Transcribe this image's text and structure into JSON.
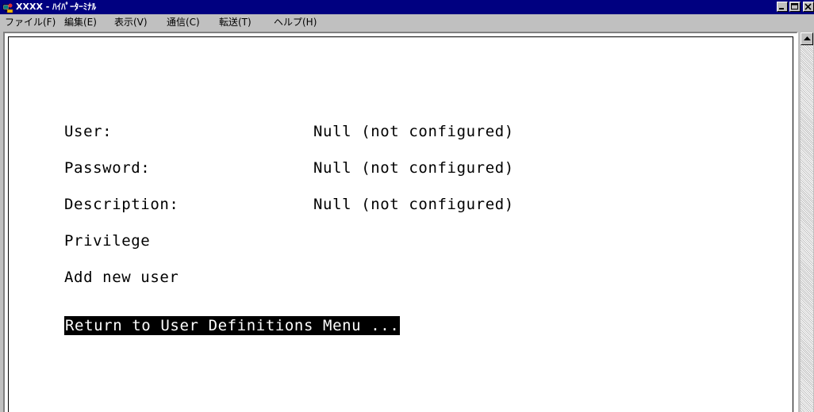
{
  "window": {
    "title": "XXXX - ﾊｲﾊﾟｰﾀｰﾐﾅﾙ"
  },
  "menu": [
    {
      "label": "ファイル(F)"
    },
    {
      "label": "編集(E)"
    },
    {
      "label": "表示(V)"
    },
    {
      "label": "通信(C)"
    },
    {
      "label": "転送(T)"
    },
    {
      "label": "ヘルプ(H)"
    }
  ],
  "terminal": {
    "fields": [
      {
        "label": "User:",
        "value": "Null (not configured)"
      },
      {
        "label": "Password:",
        "value": "Null (not configured)"
      },
      {
        "label": "Description:",
        "value": "Null (not configured)"
      }
    ],
    "options": [
      {
        "label": "Privilege"
      },
      {
        "label": "Add new user"
      }
    ],
    "selected_option": "Return to User Definitions Menu ..."
  },
  "icons": {
    "app": "hyperterminal-icon",
    "minimize": "minimize-icon",
    "maximize": "maximize-icon",
    "close": "close-icon",
    "scroll_up": "scroll-up-arrow-icon"
  },
  "colors": {
    "titlebar": "#000080",
    "face": "#c0c0c0",
    "terminal_bg": "#ffffff",
    "selection_bg": "#000000"
  }
}
